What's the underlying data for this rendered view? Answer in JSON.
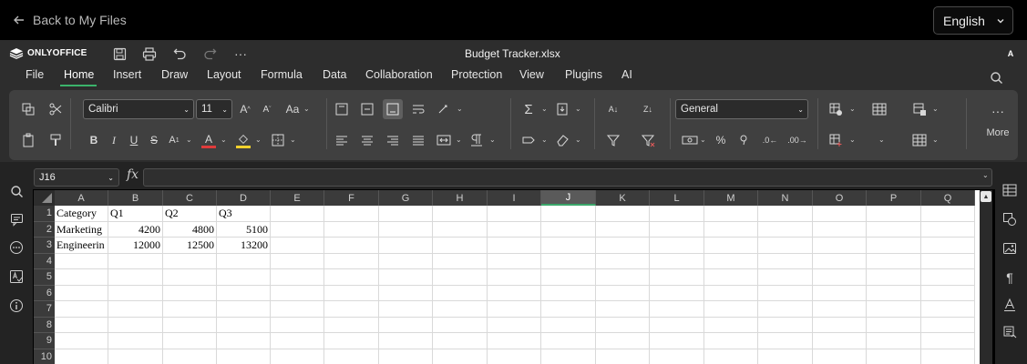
{
  "topbar": {
    "back_label": "Back to My Files",
    "language": "English"
  },
  "app": {
    "brand": "ONLYOFFICE",
    "doc_title": "Budget Tracker.xlsx",
    "avatar_initial": "A"
  },
  "menu": {
    "tabs": [
      "File",
      "Home",
      "Insert",
      "Draw",
      "Layout",
      "Formula",
      "Data",
      "Collaboration",
      "Protection",
      "View",
      "Plugins",
      "AI"
    ],
    "active": "Home"
  },
  "toolbar": {
    "font_name": "Calibri",
    "font_size": "11",
    "number_format": "General",
    "more_label": "More"
  },
  "formula_bar": {
    "cell_ref": "J16",
    "fx": "fx",
    "value": ""
  },
  "sheet": {
    "columns": [
      "A",
      "B",
      "C",
      "D",
      "E",
      "F",
      "G",
      "H",
      "I",
      "J",
      "K",
      "L",
      "M",
      "N",
      "O",
      "P",
      "Q"
    ],
    "selected_column": "J",
    "rows": [
      "1",
      "2",
      "3",
      "4",
      "5",
      "6",
      "7",
      "8",
      "9",
      "10"
    ],
    "cells": {
      "A1": "Category",
      "B1": "Q1",
      "C1": "Q2",
      "D1": "Q3",
      "A2": "Marketing",
      "B2": "4200",
      "C2": "4800",
      "D2": "5100",
      "A3": "Engineerin",
      "B3": "12000",
      "C3": "12500",
      "D3": "13200"
    }
  },
  "colors": {
    "accent": "#3bb36b",
    "toolbar_bg": "#404040",
    "chrome_bg": "#2d2d2d"
  }
}
